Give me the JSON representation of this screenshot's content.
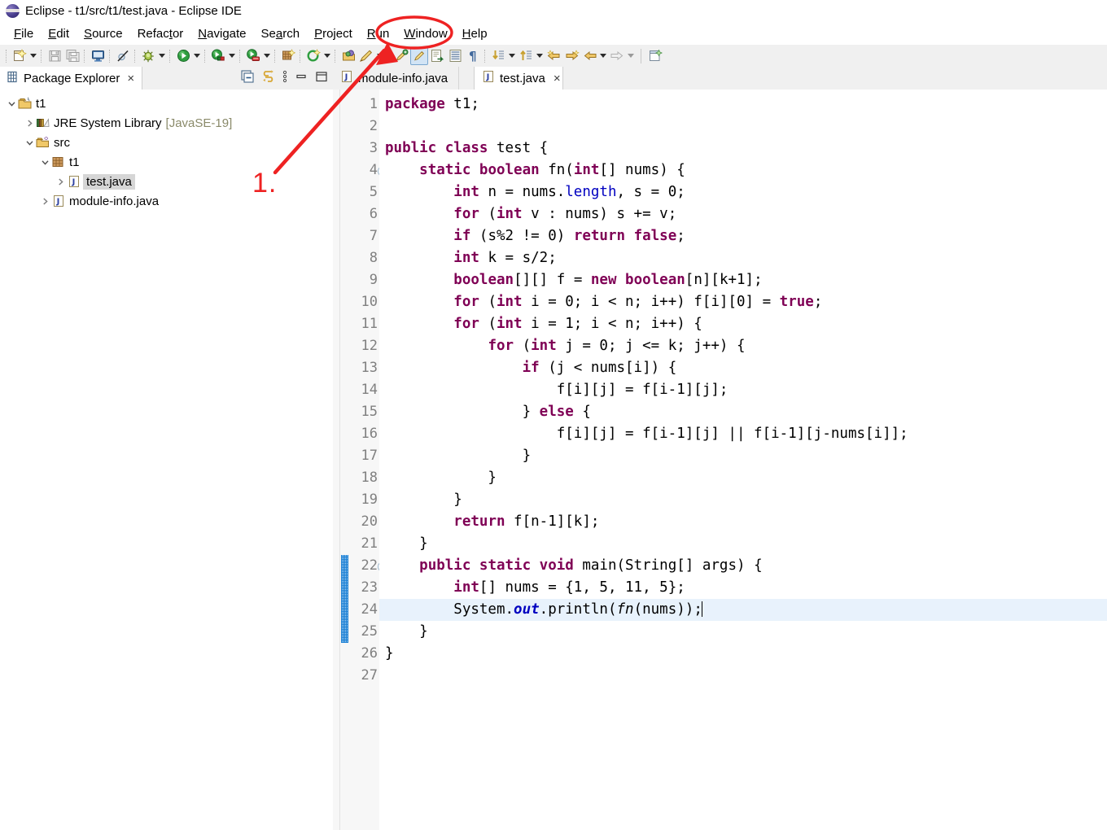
{
  "window": {
    "title": "Eclipse - t1/src/t1/test.java - Eclipse IDE",
    "icon": "eclipse-icon"
  },
  "menubar": {
    "items": [
      {
        "label": "File",
        "mnemonic": "F"
      },
      {
        "label": "Edit",
        "mnemonic": "E"
      },
      {
        "label": "Source",
        "mnemonic": "S"
      },
      {
        "label": "Refactor",
        "mnemonic": "t"
      },
      {
        "label": "Navigate",
        "mnemonic": "N"
      },
      {
        "label": "Search",
        "mnemonic": "a"
      },
      {
        "label": "Project",
        "mnemonic": "P"
      },
      {
        "label": "Run",
        "mnemonic": "R"
      },
      {
        "label": "Window",
        "mnemonic": "W"
      },
      {
        "label": "Help",
        "mnemonic": "H"
      }
    ]
  },
  "toolbar": {
    "groups": [
      [
        "new-wizard-icon",
        "new-wizard-dropdown"
      ],
      [
        "save-icon",
        "save-all-icon"
      ],
      [
        "new-java-console-icon"
      ],
      [
        "skip-breakpoints-icon"
      ],
      [
        "debug-icon",
        "debug-dropdown"
      ],
      [
        "run-icon",
        "run-dropdown"
      ],
      [
        "external-tools-icon",
        "external-tools-dropdown"
      ],
      [
        "coverage-icon",
        "coverage-dropdown"
      ],
      [
        "new-java-package-icon"
      ],
      [
        "new-java-class-icon",
        "new-java-class-dropdown"
      ],
      [
        "open-type-icon",
        "search-icon",
        "search-dropdown"
      ],
      [
        "toggle-mark-occurrences-icon"
      ],
      [
        "toggle-java-editor-breadcrumb-icon"
      ],
      [
        "open-task-icon"
      ],
      [
        "show-whitespace-icon"
      ],
      [
        "pilcrow-icon"
      ],
      [
        "next-annotation-icon",
        "next-annotation-dropdown"
      ],
      [
        "previous-annotation-icon",
        "previous-annotation-dropdown"
      ],
      [
        "back-icon",
        "forward-icon"
      ],
      [
        "previous-edit-icon",
        "previous-edit-dropdown"
      ],
      [
        "next-edit-icon",
        "next-edit-dropdown"
      ],
      [
        "new-window-icon"
      ]
    ]
  },
  "package_explorer": {
    "title": "Package Explorer",
    "close_label": "×",
    "tools": [
      "collapse-all-icon",
      "link-with-editor-icon",
      "view-menu-icon",
      "minimize-icon",
      "maximize-icon"
    ],
    "tree": [
      {
        "label": "t1",
        "sub": "",
        "depth": 0,
        "twist": "open",
        "icon": "java-project-icon",
        "selected": false
      },
      {
        "label": "JRE System Library",
        "sub": "[JavaSE-19]",
        "depth": 1,
        "twist": "closed",
        "icon": "jre-library-icon",
        "selected": false
      },
      {
        "label": "src",
        "sub": "",
        "depth": 1,
        "twist": "open",
        "icon": "source-folder-icon",
        "selected": false
      },
      {
        "label": "t1",
        "sub": "",
        "depth": 2,
        "twist": "open",
        "icon": "package-icon",
        "selected": false
      },
      {
        "label": "test.java",
        "sub": "",
        "depth": 3,
        "twist": "closed",
        "icon": "java-file-icon",
        "selected": true
      },
      {
        "label": "module-info.java",
        "sub": "",
        "depth": 2,
        "twist": "closed",
        "icon": "java-file-icon",
        "selected": false
      }
    ]
  },
  "editor": {
    "tabs": [
      {
        "label": "module-info.java",
        "icon": "java-file-icon",
        "active": false,
        "closable": false
      },
      {
        "label": "test.java",
        "icon": "java-file-icon",
        "active": true,
        "closable": true,
        "close_label": "×"
      }
    ],
    "active_file": "test.java",
    "current_line": 24,
    "change_bar_lines": [
      22,
      23,
      24,
      25
    ],
    "fold_markers": [
      4,
      22
    ],
    "lines": [
      {
        "no": 1,
        "tokens": [
          {
            "t": "package",
            "c": "k"
          },
          {
            "t": " t1;",
            "c": ""
          }
        ]
      },
      {
        "no": 2,
        "tokens": []
      },
      {
        "no": 3,
        "tokens": [
          {
            "t": "public class",
            "c": "k"
          },
          {
            "t": " test {",
            "c": ""
          }
        ]
      },
      {
        "no": 4,
        "tokens": [
          {
            "t": "    ",
            "c": ""
          },
          {
            "t": "static boolean",
            "c": "k"
          },
          {
            "t": " fn(",
            "c": ""
          },
          {
            "t": "int",
            "c": "k"
          },
          {
            "t": "[] nums) {",
            "c": ""
          }
        ]
      },
      {
        "no": 5,
        "tokens": [
          {
            "t": "        ",
            "c": ""
          },
          {
            "t": "int",
            "c": "k"
          },
          {
            "t": " n = nums.",
            "c": ""
          },
          {
            "t": "length",
            "c": "f"
          },
          {
            "t": ", s = 0;",
            "c": ""
          }
        ]
      },
      {
        "no": 6,
        "tokens": [
          {
            "t": "        ",
            "c": ""
          },
          {
            "t": "for",
            "c": "k"
          },
          {
            "t": " (",
            "c": ""
          },
          {
            "t": "int",
            "c": "k"
          },
          {
            "t": " v : nums) s += v;",
            "c": ""
          }
        ]
      },
      {
        "no": 7,
        "tokens": [
          {
            "t": "        ",
            "c": ""
          },
          {
            "t": "if",
            "c": "k"
          },
          {
            "t": " (s%2 != 0) ",
            "c": ""
          },
          {
            "t": "return false",
            "c": "k"
          },
          {
            "t": ";",
            "c": ""
          }
        ]
      },
      {
        "no": 8,
        "tokens": [
          {
            "t": "        ",
            "c": ""
          },
          {
            "t": "int",
            "c": "k"
          },
          {
            "t": " k = s/2;",
            "c": ""
          }
        ]
      },
      {
        "no": 9,
        "tokens": [
          {
            "t": "        ",
            "c": ""
          },
          {
            "t": "boolean",
            "c": "k"
          },
          {
            "t": "[][] f = ",
            "c": ""
          },
          {
            "t": "new boolean",
            "c": "k"
          },
          {
            "t": "[n][k+1];",
            "c": ""
          }
        ]
      },
      {
        "no": 10,
        "tokens": [
          {
            "t": "        ",
            "c": ""
          },
          {
            "t": "for",
            "c": "k"
          },
          {
            "t": " (",
            "c": ""
          },
          {
            "t": "int",
            "c": "k"
          },
          {
            "t": " i = 0; i < n; i++) f[i][0] = ",
            "c": ""
          },
          {
            "t": "true",
            "c": "k"
          },
          {
            "t": ";",
            "c": ""
          }
        ]
      },
      {
        "no": 11,
        "tokens": [
          {
            "t": "        ",
            "c": ""
          },
          {
            "t": "for",
            "c": "k"
          },
          {
            "t": " (",
            "c": ""
          },
          {
            "t": "int",
            "c": "k"
          },
          {
            "t": " i = 1; i < n; i++) {",
            "c": ""
          }
        ]
      },
      {
        "no": 12,
        "tokens": [
          {
            "t": "            ",
            "c": ""
          },
          {
            "t": "for",
            "c": "k"
          },
          {
            "t": " (",
            "c": ""
          },
          {
            "t": "int",
            "c": "k"
          },
          {
            "t": " j = 0; j <= k; j++) {",
            "c": ""
          }
        ]
      },
      {
        "no": 13,
        "tokens": [
          {
            "t": "                ",
            "c": ""
          },
          {
            "t": "if",
            "c": "k"
          },
          {
            "t": " (j < nums[i]) {",
            "c": ""
          }
        ]
      },
      {
        "no": 14,
        "tokens": [
          {
            "t": "                    f[i][j] = f[i-1][j];",
            "c": ""
          }
        ]
      },
      {
        "no": 15,
        "tokens": [
          {
            "t": "                } ",
            "c": ""
          },
          {
            "t": "else",
            "c": "k"
          },
          {
            "t": " {",
            "c": ""
          }
        ]
      },
      {
        "no": 16,
        "tokens": [
          {
            "t": "                    f[i][j] = f[i-1][j] || f[i-1][j-nums[i]];",
            "c": ""
          }
        ]
      },
      {
        "no": 17,
        "tokens": [
          {
            "t": "                }",
            "c": ""
          }
        ]
      },
      {
        "no": 18,
        "tokens": [
          {
            "t": "            }",
            "c": ""
          }
        ]
      },
      {
        "no": 19,
        "tokens": [
          {
            "t": "        }",
            "c": ""
          }
        ]
      },
      {
        "no": 20,
        "tokens": [
          {
            "t": "        ",
            "c": ""
          },
          {
            "t": "return",
            "c": "k"
          },
          {
            "t": " f[n-1][k];",
            "c": ""
          }
        ]
      },
      {
        "no": 21,
        "tokens": [
          {
            "t": "    }",
            "c": ""
          }
        ]
      },
      {
        "no": 22,
        "tokens": [
          {
            "t": "    ",
            "c": ""
          },
          {
            "t": "public static void",
            "c": "k"
          },
          {
            "t": " main(String[] args) {",
            "c": ""
          }
        ]
      },
      {
        "no": 23,
        "tokens": [
          {
            "t": "        ",
            "c": ""
          },
          {
            "t": "int",
            "c": "k"
          },
          {
            "t": "[] nums = {1, 5, 11, 5};",
            "c": ""
          }
        ]
      },
      {
        "no": 24,
        "tokens": [
          {
            "t": "        System.",
            "c": ""
          },
          {
            "t": "out",
            "c": "sf"
          },
          {
            "t": ".println(",
            "c": ""
          },
          {
            "t": "fn",
            "c": "mi"
          },
          {
            "t": "(nums));",
            "c": ""
          }
        ],
        "caret": true
      },
      {
        "no": 25,
        "tokens": [
          {
            "t": "    }",
            "c": ""
          }
        ]
      },
      {
        "no": 26,
        "tokens": [
          {
            "t": "}",
            "c": ""
          }
        ]
      },
      {
        "no": 27,
        "tokens": []
      }
    ]
  },
  "annotation": {
    "step_label": "1.",
    "color": "#ee2222",
    "target_menu": "Window",
    "shapes": [
      "ellipse-highlight",
      "arrow-pointer"
    ]
  },
  "colors": {
    "keyword": "#7f0055",
    "field": "#0000c0",
    "current_line_bg": "#e8f2fc",
    "gutter_bg": "#f7f7f7",
    "line_number": "#808080",
    "change_bar": "#1a7fd4",
    "annotation_red": "#ee2222",
    "selection_bg": "#d6d6d6"
  }
}
